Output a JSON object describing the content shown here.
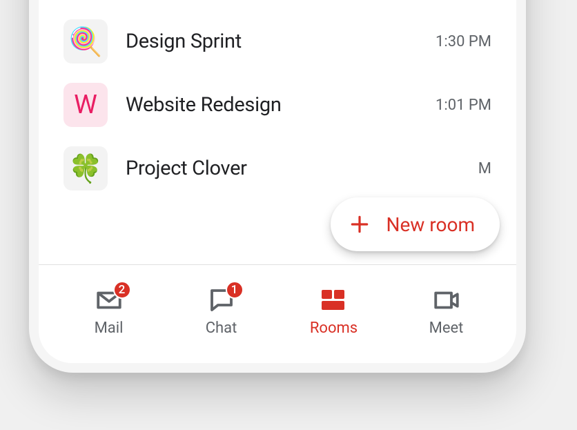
{
  "rooms": [
    {
      "name": "Design Sprint",
      "time": "1:30 PM",
      "avatar_emoji": "🍭",
      "avatar_class": "avatar-lollipop"
    },
    {
      "name": "Website Redesign",
      "time": "1:01 PM",
      "avatar_letter": "W",
      "avatar_class": "avatar-w"
    },
    {
      "name": "Project Clover",
      "time": "M",
      "avatar_emoji": "🍀",
      "avatar_class": "avatar-clover"
    }
  ],
  "fab": {
    "label": "New room"
  },
  "nav": {
    "mail": {
      "label": "Mail",
      "badge": "2"
    },
    "chat": {
      "label": "Chat",
      "badge": "1"
    },
    "rooms": {
      "label": "Rooms"
    },
    "meet": {
      "label": "Meet"
    }
  }
}
